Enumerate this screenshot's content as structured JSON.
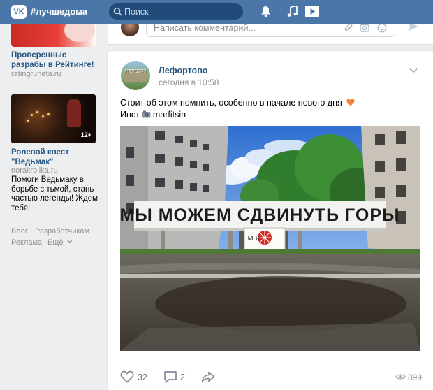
{
  "header": {
    "logo_text": "VK",
    "hashtag": "#лучшедома",
    "search_placeholder": "Поиск",
    "icons": [
      "bell-icon",
      "music-icon",
      "play-icon"
    ]
  },
  "sidebar": {
    "ad1": {
      "title": "Проверенные разрабы в Рейтинге!",
      "domain": "ratingruneta.ru"
    },
    "ad2": {
      "age": "12+",
      "title": "Ролевой квест \"Ведьмак\"",
      "domain": "norakrolika.ru",
      "description": "Помоги Ведьмаку в борьбе с тьмой, стань частью легенды! Ждем тебя!"
    },
    "footer": {
      "blog": "Блог",
      "developers": "Разработчикам",
      "ads": "Реклама",
      "more": "Ещё"
    }
  },
  "prev_post": {
    "comment_placeholder": "Написать комментарий..."
  },
  "post": {
    "author": "Лефортово",
    "avatar_sign": "ЛЕФОРТОВО",
    "time": "сегодня в 10:58",
    "text_line1": "Стоит об этом помнить, особенно в начале нового дня",
    "text_line2_prefix": "Инст",
    "instagram_handle": "marfitsin",
    "photo": {
      "banner_text": "МЫ МОЖЕМ СДВИНУТЬ ГОРЫ",
      "sign_text": "М  И"
    },
    "likes": "32",
    "comments": "2",
    "views": "899"
  },
  "colors": {
    "header": "#4a76a8",
    "link": "#2a5885",
    "page_bg": "#edeef0",
    "muted": "#939393"
  }
}
